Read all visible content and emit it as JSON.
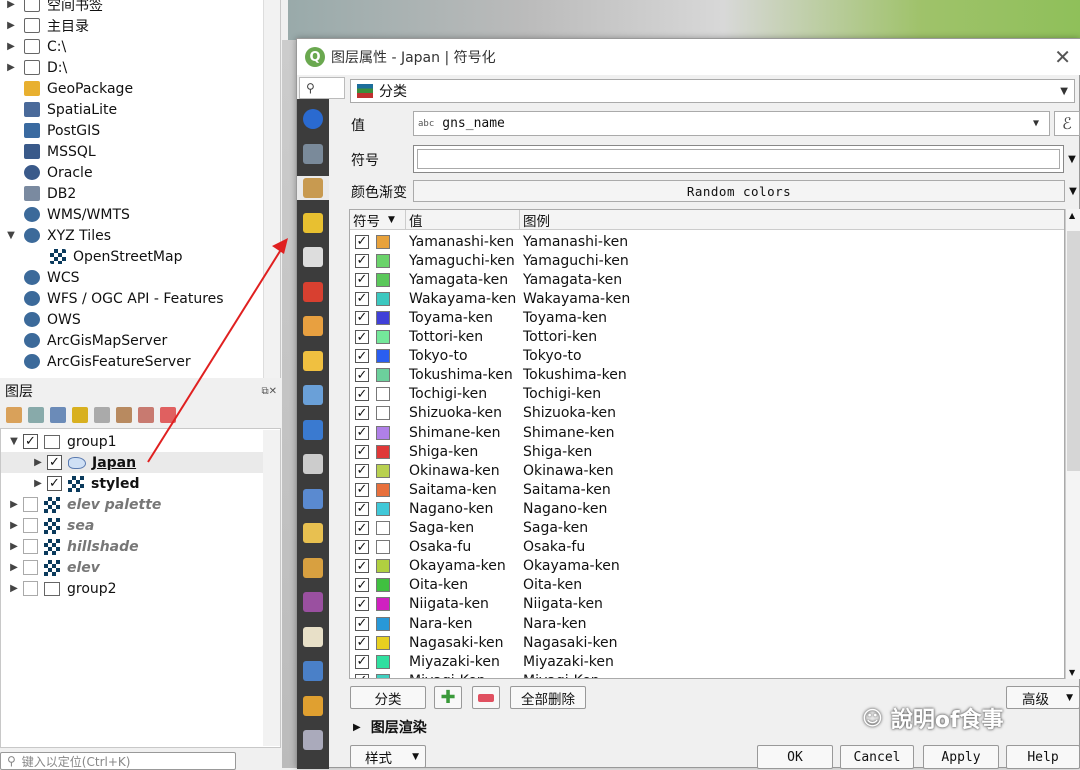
{
  "browser": {
    "items": [
      {
        "label": "空间书签",
        "icon": "bookmark-icon",
        "expand": true
      },
      {
        "label": "主目录",
        "icon": "home-icon",
        "expand": true
      },
      {
        "label": "C:\\",
        "icon": "folder-icon",
        "expand": true
      },
      {
        "label": "D:\\",
        "icon": "folder-icon",
        "expand": true
      },
      {
        "label": "GeoPackage",
        "icon": "geopackage-icon",
        "expand": false
      },
      {
        "label": "SpatiaLite",
        "icon": "spatialite-icon",
        "expand": false
      },
      {
        "label": "PostGIS",
        "icon": "postgis-icon",
        "expand": false
      },
      {
        "label": "MSSQL",
        "icon": "mssql-icon",
        "expand": false
      },
      {
        "label": "Oracle",
        "icon": "oracle-icon",
        "expand": false
      },
      {
        "label": "DB2",
        "icon": "db2-icon",
        "expand": false
      },
      {
        "label": "WMS/WMTS",
        "icon": "globe-icon",
        "expand": false
      },
      {
        "label": "XYZ Tiles",
        "icon": "globe-icon",
        "expand": true,
        "open": true
      },
      {
        "label": "OpenStreetMap",
        "icon": "tiles-icon",
        "expand": false,
        "child": true
      },
      {
        "label": "WCS",
        "icon": "globe-icon",
        "expand": false
      },
      {
        "label": "WFS / OGC API - Features",
        "icon": "globe-icon",
        "expand": false
      },
      {
        "label": "OWS",
        "icon": "globe-icon",
        "expand": false
      },
      {
        "label": "ArcGisMapServer",
        "icon": "globe-icon",
        "expand": false
      },
      {
        "label": "ArcGisFeatureServer",
        "icon": "globe-icon",
        "expand": false
      }
    ]
  },
  "layers": {
    "title": "图层",
    "items": [
      {
        "label": "group1",
        "checked": true,
        "kind": "group",
        "level": 0,
        "open": true
      },
      {
        "label": "Japan",
        "checked": true,
        "kind": "polygon",
        "level": 1
      },
      {
        "label": "styled",
        "checked": true,
        "kind": "raster",
        "level": 1
      },
      {
        "label": "elev palette",
        "checked": false,
        "kind": "raster",
        "level": 0
      },
      {
        "label": "sea",
        "checked": false,
        "kind": "raster",
        "level": 0
      },
      {
        "label": "hillshade",
        "checked": false,
        "kind": "raster",
        "level": 0
      },
      {
        "label": "elev",
        "checked": false,
        "kind": "raster",
        "level": 0
      },
      {
        "label": "group2",
        "checked": false,
        "kind": "group",
        "level": 0
      }
    ],
    "locator_placeholder": "键入以定位(Ctrl+K)"
  },
  "dialog": {
    "title": "图层属性 - Japan | 符号化",
    "renderer": "分类",
    "value_label": "值",
    "value_field": "gns_name",
    "value_type": "abc",
    "symbol_label": "符号",
    "ramp_label": "颜色渐变",
    "ramp_value": "Random colors",
    "columns": [
      "符号",
      "值",
      "图例"
    ],
    "rows": [
      {
        "value": "Yamanashi-ken",
        "legend": "Yamanashi-ken",
        "color": "#e8a23c"
      },
      {
        "value": "Yamaguchi-ken",
        "legend": "Yamaguchi-ken",
        "color": "#6bd36b"
      },
      {
        "value": "Yamagata-ken",
        "legend": "Yamagata-ken",
        "color": "#5bc85b"
      },
      {
        "value": "Wakayama-ken",
        "legend": "Wakayama-ken",
        "color": "#3cc8c0"
      },
      {
        "value": "Toyama-ken",
        "legend": "Toyama-ken",
        "color": "#4040d8"
      },
      {
        "value": "Tottori-ken",
        "legend": "Tottori-ken",
        "color": "#74e89a"
      },
      {
        "value": "Tokyo-to",
        "legend": "Tokyo-to",
        "color": "#2a5ef0"
      },
      {
        "value": "Tokushima-ken",
        "legend": "Tokushima-ken",
        "color": "#6cd09c"
      },
      {
        "value": "Tochigi-ken",
        "legend": "Tochigi-ken",
        "color": "#ffffff"
      },
      {
        "value": "Shizuoka-ken",
        "legend": "Shizuoka-ken",
        "color": "#ffffff"
      },
      {
        "value": "Shimane-ken",
        "legend": "Shimane-ken",
        "color": "#b080e8"
      },
      {
        "value": "Shiga-ken",
        "legend": "Shiga-ken",
        "color": "#e03838"
      },
      {
        "value": "Okinawa-ken",
        "legend": "Okinawa-ken",
        "color": "#b8d050"
      },
      {
        "value": "Saitama-ken",
        "legend": "Saitama-ken",
        "color": "#e8703c"
      },
      {
        "value": "Nagano-ken",
        "legend": "Nagano-ken",
        "color": "#40c8d8"
      },
      {
        "value": "Saga-ken",
        "legend": "Saga-ken",
        "color": "#ffffff"
      },
      {
        "value": "Osaka-fu",
        "legend": "Osaka-fu",
        "color": "#ffffff"
      },
      {
        "value": "Okayama-ken",
        "legend": "Okayama-ken",
        "color": "#b0d040"
      },
      {
        "value": "Oita-ken",
        "legend": "Oita-ken",
        "color": "#40c040"
      },
      {
        "value": "Niigata-ken",
        "legend": "Niigata-ken",
        "color": "#d020c0"
      },
      {
        "value": "Nara-ken",
        "legend": "Nara-ken",
        "color": "#2898d8"
      },
      {
        "value": "Nagasaki-ken",
        "legend": "Nagasaki-ken",
        "color": "#e8d020"
      },
      {
        "value": "Miyazaki-ken",
        "legend": "Miyazaki-ken",
        "color": "#30e0a0"
      },
      {
        "value": "Miyagi-Ken",
        "legend": "Miyagi-Ken",
        "color": "#40d0c0"
      }
    ],
    "classify_btn": "分类",
    "delete_all_btn": "全部删除",
    "advanced_btn": "高级",
    "rendering_label": "图层渲染",
    "style_btn": "样式",
    "ok_btn": "OK",
    "cancel_btn": "Cancel",
    "apply_btn": "Apply",
    "help_btn": "Help"
  },
  "watermark": "說明of食事",
  "colors": {
    "accent": "#e02020",
    "qgis_green": "#6aa84f",
    "vtab_bg": "#3c3c3c"
  }
}
